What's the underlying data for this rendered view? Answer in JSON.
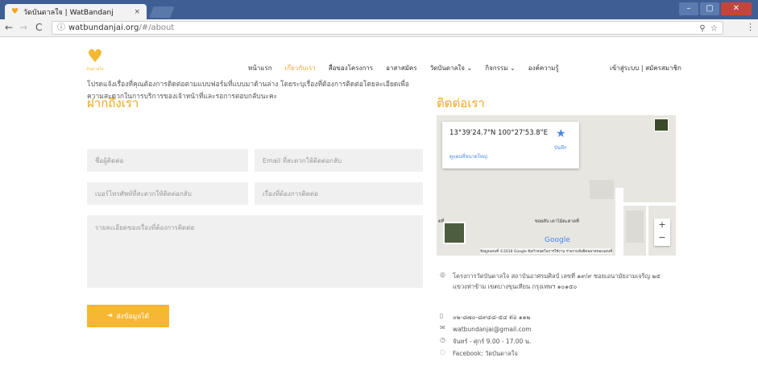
{
  "browser": {
    "tab_title": "วัดบันดาลใจ | WatBandanj",
    "tab_close": "×",
    "url_host": "watbundanjai.org",
    "url_path": "/#/about",
    "window_controls": {
      "minimize": "–",
      "maximize": "▢",
      "close": "✕"
    }
  },
  "site": {
    "logo_text": "บันดาลใจ",
    "nav": [
      {
        "label": "หน้าแรก"
      },
      {
        "label": "เกี่ยวกับเรา"
      },
      {
        "label": "สื่อของโครงการ"
      },
      {
        "label": "อาสาสมัคร"
      },
      {
        "label": "วัดบันดาลใจ ⌄"
      },
      {
        "label": "กิจกรรม ⌄"
      },
      {
        "label": "องค์ความรู้"
      }
    ],
    "auth_link": "เข้าสู่ระบบ | สมัครสมาชิก"
  },
  "contact_form": {
    "title": "ฝากถึงเรา",
    "intro": "โปรดแจ้งเรื่องที่คุณต้องการติดต่อตามแบบฟอร์มที่แบบมาด้านล่าง โดยระบุเรื่องที่ต้องการติดต่อโดยละเอียดเพื่อความสะดวกในการบริการของเจ้าหน้าที่และรอการตอบกลับนะคะ",
    "name_placeholder": "ชื่อผู้ติดต่อ",
    "email_placeholder": "Email ที่สะดวกให้ติดต่อกลับ",
    "phone_placeholder": "เบอร์โทรศัพท์ที่สะดวกให้ติดต่อกลับ",
    "subject_placeholder": "เรื่องที่ต้องการติดต่อ",
    "details_placeholder": "รายละเอียดของเรื่องที่ต้องการติดต่อ",
    "submit_icon": "➔",
    "submit_label": "ส่งข้อมูลได้"
  },
  "contact_info": {
    "title": "ติดต่อเรา",
    "map": {
      "coords": "13°39'24.7\"N 100°27'53.8\"E",
      "save_label": "บันทึก",
      "link_label": "ดูแผนที่ขนาดใหญ่",
      "place_label": "ซอยคับ เคาไม้ตะคาดที่",
      "left_label": "ตที่",
      "google": "Google",
      "attribution": "ข้อมูลแผนที่ ©2018 Google   ข้อกำหนดในการใช้งาน   รายงานข้อผิดพลาดของแผนที่",
      "zoom_in": "+",
      "zoom_out": "−"
    },
    "address": "โครงการวัดบันดาลใจ สถาบันอาศรมศิลป์ เลขที่ ๑๙/๙ ซอยเอนามัยงามเจริญ ๒๕",
    "address2": "แขวงท่าข้าม เขตบางขุนเทียน กรุงเทพฯ ๑๐๑๕๐",
    "phone": "๐๒-๘๗๐-๘๙๔๘-๕๔ ต่อ ๑๑๒",
    "email": "watbundanjai@gmail.com",
    "hours": "จันทร์ - ศุกร์ 9.00 - 17.00 น.",
    "facebook": "Facebook: วัดบันดาลใจ"
  }
}
